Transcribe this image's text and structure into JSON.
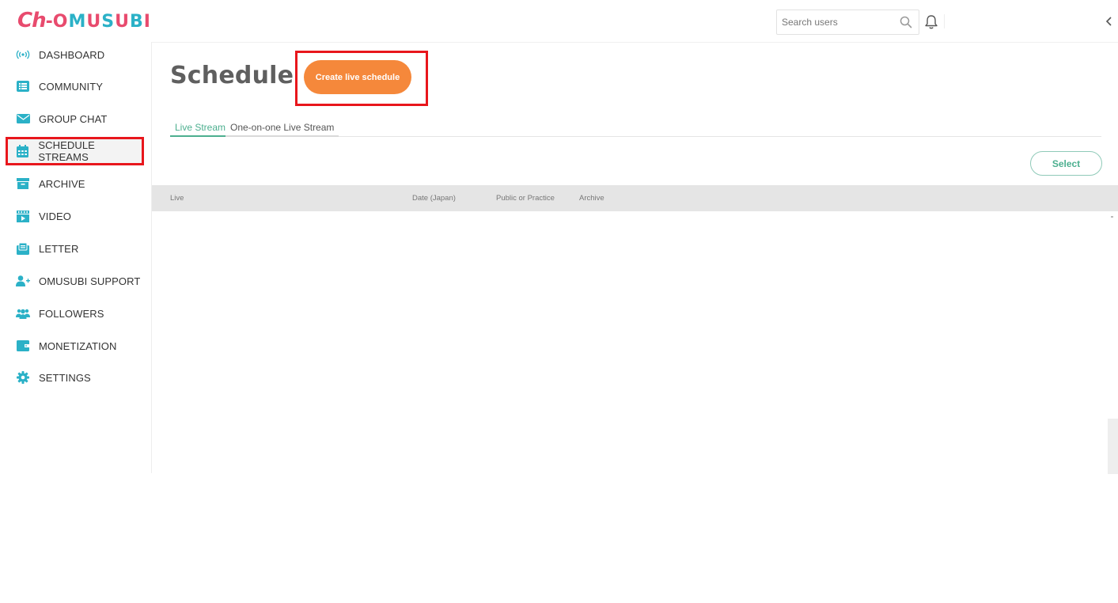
{
  "header": {
    "logo": {
      "prefix": "Ch",
      "dash": "-",
      "letters": [
        "O",
        "M",
        "U",
        "S",
        "U",
        "B",
        "I"
      ]
    },
    "search": {
      "placeholder": "Search users",
      "value": ""
    },
    "icons": {
      "search": "search-icon",
      "bell": "bell-icon",
      "collapse": "chevron-left-icon"
    }
  },
  "sidebar": {
    "items": [
      {
        "label": "DASHBOARD",
        "icon": "broadcast-icon"
      },
      {
        "label": "COMMUNITY",
        "icon": "list-icon"
      },
      {
        "label": "GROUP CHAT",
        "icon": "envelope-icon"
      },
      {
        "label": "SCHEDULE STREAMS",
        "icon": "calendar-icon",
        "active": true
      },
      {
        "label": "ARCHIVE",
        "icon": "archive-box-icon"
      },
      {
        "label": "VIDEO",
        "icon": "video-icon"
      },
      {
        "label": "LETTER",
        "icon": "letter-icon"
      },
      {
        "label": "OMUSUBI SUPPORT",
        "icon": "user-plus-icon"
      },
      {
        "label": "FOLLOWERS",
        "icon": "users-icon"
      },
      {
        "label": "MONETIZATION",
        "icon": "wallet-icon"
      },
      {
        "label": "SETTINGS",
        "icon": "gear-icon"
      }
    ]
  },
  "main": {
    "title": "Schedule",
    "create_button": "Create live schedule",
    "tabs": [
      {
        "label": "Live Stream",
        "active": true
      },
      {
        "label": "One-on-one Live Stream",
        "active": false
      }
    ],
    "select_button": "Select",
    "table": {
      "columns": [
        "Live",
        "Date (Japan)",
        "Public or Practice",
        "Archive"
      ],
      "rows": []
    }
  },
  "colors": {
    "brand_pink": "#e84b6e",
    "brand_teal": "#2bb1c7",
    "accent_orange": "#f5883b",
    "accent_green": "#4caf8f",
    "highlight_red": "#e8161c"
  }
}
